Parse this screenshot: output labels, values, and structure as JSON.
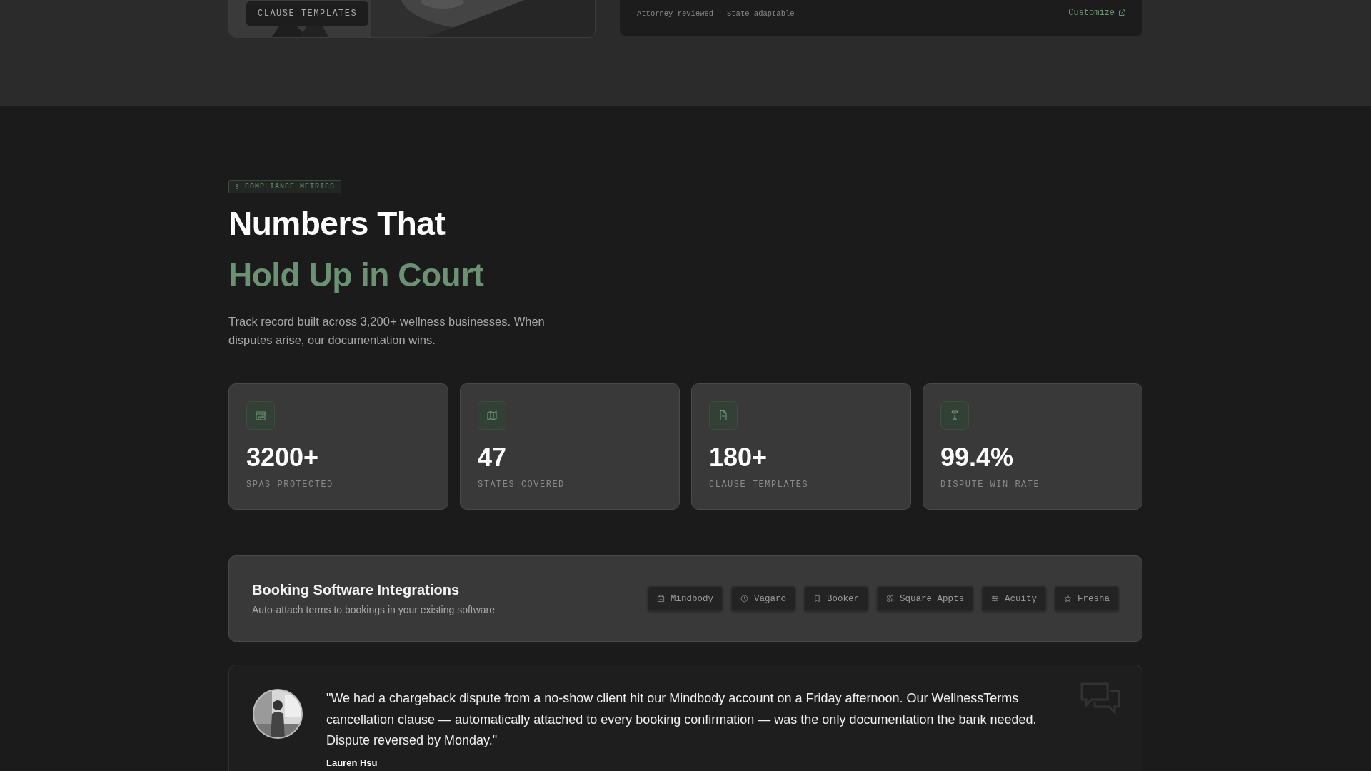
{
  "top_cards": {
    "image_card": {
      "kind": "picture",
      "label": "CLAUSE TEMPLATES"
    },
    "info_card": {
      "meta": "Attorney-reviewed · State-adaptable",
      "link": "Customize"
    }
  },
  "metrics": {
    "badge": "§ COMPLIANCE METRICS",
    "title_line1": "Numbers That",
    "title_line2": "Hold Up in Court",
    "description": "Track record built across 3,200+ wellness businesses. When disputes arise, our documentation wins.",
    "stats": [
      {
        "value": "3200+",
        "label": "SPAS PROTECTED"
      },
      {
        "value": "47",
        "label": "STATES COVERED"
      },
      {
        "value": "180+",
        "label": "CLAUSE TEMPLATES"
      },
      {
        "value": "99.4%",
        "label": "DISPUTE WIN RATE"
      }
    ]
  },
  "integrations": {
    "title": "Booking Software Integrations",
    "subtitle": "Auto-attach terms to bookings in your existing software",
    "chips": [
      {
        "label": "Mindbody"
      },
      {
        "label": "Vagaro"
      },
      {
        "label": "Booker"
      },
      {
        "label": "Square Appts"
      },
      {
        "label": "Acuity"
      },
      {
        "label": "Fresha"
      }
    ]
  },
  "testimonial": {
    "quote": "\"We had a chargeback dispute from a no-show client hit our Mindbody account on a Friday afternoon. Our WellnessTerms cancellation clause — automatically attached to every booking confirmation — was the only documentation the bank needed. Dispute reversed by Monday.\"",
    "author": "Lauren Hsu"
  }
}
